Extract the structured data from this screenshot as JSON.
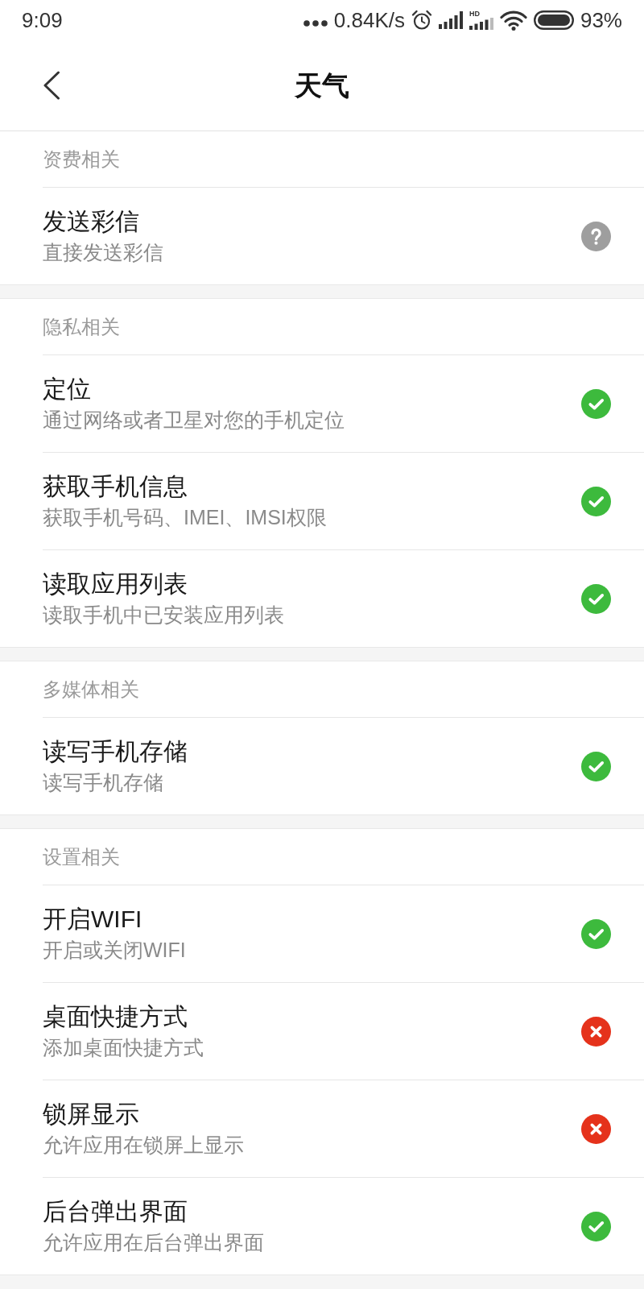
{
  "status_bar": {
    "time": "9:09",
    "network_speed": "0.84K/s",
    "signal_label": "HD",
    "battery": "93%"
  },
  "header": {
    "title": "天气"
  },
  "sections": [
    {
      "title": "资费相关",
      "items": [
        {
          "title": "发送彩信",
          "description": "直接发送彩信",
          "kind": "ask"
        }
      ]
    },
    {
      "title": "隐私相关",
      "items": [
        {
          "title": "定位",
          "description": "通过网络或者卫星对您的手机定位",
          "kind": "allowed"
        },
        {
          "title": "获取手机信息",
          "description": "获取手机号码、IMEI、IMSI权限",
          "kind": "allowed"
        },
        {
          "title": "读取应用列表",
          "description": "读取手机中已安装应用列表",
          "kind": "allowed"
        }
      ]
    },
    {
      "title": "多媒体相关",
      "items": [
        {
          "title": "读写手机存储",
          "description": "读写手机存储",
          "kind": "allowed"
        }
      ]
    },
    {
      "title": "设置相关",
      "items": [
        {
          "title": "开启WIFI",
          "description": "开启或关闭WIFI",
          "kind": "allowed"
        },
        {
          "title": "桌面快捷方式",
          "description": "添加桌面快捷方式",
          "kind": "denied"
        },
        {
          "title": "锁屏显示",
          "description": "允许应用在锁屏上显示",
          "kind": "denied"
        },
        {
          "title": "后台弹出界面",
          "description": "允许应用在后台弹出界面",
          "kind": "allowed"
        }
      ]
    }
  ]
}
